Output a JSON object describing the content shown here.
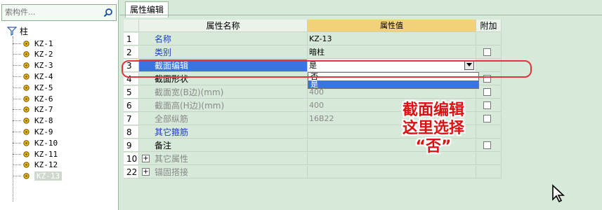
{
  "sidebar": {
    "search_placeholder": "索构件...",
    "root_label": "柱",
    "items": [
      "KZ-1",
      "KZ-2",
      "KZ-3",
      "KZ-4",
      "KZ-5",
      "KZ-6",
      "KZ-7",
      "KZ-8",
      "KZ-9",
      "KZ-10",
      "KZ-11",
      "KZ-12",
      "KZ-13"
    ]
  },
  "tab": {
    "label": "属性编辑"
  },
  "grid": {
    "headers": {
      "name": "属性名称",
      "value": "属性值",
      "add": "附加"
    },
    "rows": [
      {
        "num": "1",
        "name": "名称",
        "value": "KZ-13",
        "style": "blue",
        "check": false
      },
      {
        "num": "2",
        "name": "类别",
        "value": "暗柱",
        "style": "blue",
        "check": true
      },
      {
        "num": "3",
        "name": "截面编辑",
        "value": "是",
        "style": "sel",
        "check": false
      },
      {
        "num": "4",
        "name": "截面形状",
        "value": "",
        "style": "",
        "check": true
      },
      {
        "num": "5",
        "name": "截面宽(B边)(mm)",
        "value": "400",
        "style": "grey",
        "check": true
      },
      {
        "num": "6",
        "name": "截面高(H边)(mm)",
        "value": "400",
        "style": "grey",
        "check": true
      },
      {
        "num": "7",
        "name": "全部纵筋",
        "value": "16B22",
        "style": "grey",
        "check": true
      },
      {
        "num": "8",
        "name": "其它箍筋",
        "value": "",
        "style": "blue",
        "check": false
      },
      {
        "num": "9",
        "name": "备注",
        "value": "",
        "style": "",
        "check": true
      },
      {
        "num": "10",
        "name": "其它属性",
        "value": "",
        "style": "grey",
        "expand": true,
        "check": false
      },
      {
        "num": "22",
        "name": "锚固搭接",
        "value": "",
        "style": "grey",
        "expand": true,
        "check": false
      }
    ],
    "dropdown_options": [
      "否",
      "是"
    ]
  },
  "annotation": {
    "line1": "截面编辑",
    "line2": "这里选择",
    "line3": "“否”"
  },
  "colors": {
    "highlight": "#e2343b",
    "selection": "#3a74e0",
    "header_accent": "#f3d07a"
  }
}
